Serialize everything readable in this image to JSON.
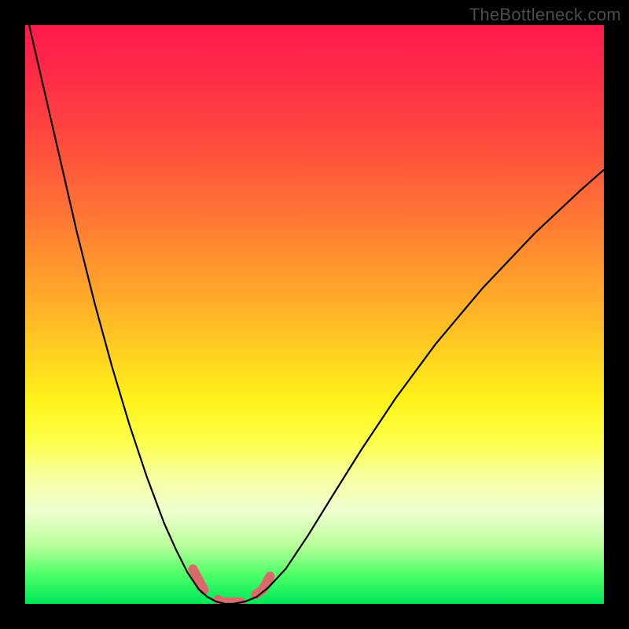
{
  "watermark": "TheBottleneck.com",
  "chart_data": {
    "type": "line",
    "title": "",
    "xlabel": "",
    "ylabel": "",
    "xlim": [
      0,
      1
    ],
    "ylim": [
      0,
      1
    ],
    "grid": false,
    "legend": false,
    "annotations": [],
    "background_gradient_stops": [
      {
        "pos": 0.0,
        "color": "#ff1a4d"
      },
      {
        "pos": 0.2,
        "color": "#ff4a3e"
      },
      {
        "pos": 0.46,
        "color": "#ffa62a"
      },
      {
        "pos": 0.65,
        "color": "#fff31a"
      },
      {
        "pos": 0.84,
        "color": "#eeffd0"
      },
      {
        "pos": 1.0,
        "color": "#00e85a"
      }
    ],
    "series": [
      {
        "name": "bottleneck-curve",
        "stroke": "#000000",
        "stroke_width": 2.2,
        "x": [
          0.0,
          0.03,
          0.06,
          0.09,
          0.12,
          0.15,
          0.18,
          0.21,
          0.24,
          0.26,
          0.28,
          0.3,
          0.315,
          0.33,
          0.345,
          0.36,
          0.38,
          0.4,
          0.42,
          0.45,
          0.49,
          0.53,
          0.58,
          0.64,
          0.71,
          0.79,
          0.88,
          0.96,
          1.0
        ],
        "y": [
          1.03,
          0.9,
          0.77,
          0.64,
          0.52,
          0.41,
          0.31,
          0.22,
          0.14,
          0.095,
          0.055,
          0.025,
          0.012,
          0.004,
          0.0,
          0.0,
          0.004,
          0.012,
          0.028,
          0.06,
          0.12,
          0.185,
          0.265,
          0.355,
          0.45,
          0.545,
          0.64,
          0.715,
          0.75
        ]
      },
      {
        "name": "trough-marker",
        "type": "dash-marker",
        "stroke": "#d96a6a",
        "stroke_width": 12,
        "linecap": "round",
        "dash": [
          30,
          22
        ],
        "x": [
          0.29,
          0.31,
          0.34,
          0.38,
          0.41,
          0.43
        ],
        "y": [
          0.06,
          0.022,
          0.003,
          0.003,
          0.024,
          0.06
        ]
      }
    ]
  }
}
